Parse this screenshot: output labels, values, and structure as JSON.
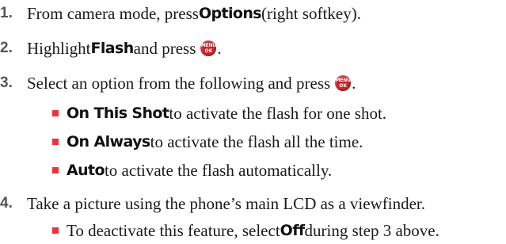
{
  "colors": {
    "bullet": "#e8353a",
    "step_number": "#555555",
    "menu_button": "#c8262b"
  },
  "menu_icon": {
    "icon": "menu-ok-button-icon",
    "top_text": "MENU",
    "bottom_text": "OK"
  },
  "steps": [
    {
      "number": "1.",
      "text_before": "From camera mode, press ",
      "key": "Options",
      "text_after": " (right softkey)."
    },
    {
      "number": "2.",
      "text_before": "Highlight ",
      "key": "Flash",
      "text_after": " and press ",
      "end": "."
    },
    {
      "number": "3.",
      "text_before": "Select an option from the following and press ",
      "end": ".",
      "options": [
        {
          "key": "On This Shot",
          "text": " to activate the flash for one shot."
        },
        {
          "key": "On Always",
          "text": " to activate the flash all the time."
        },
        {
          "key": "Auto",
          "text": " to activate the flash automatically."
        }
      ]
    },
    {
      "number": "4.",
      "text_before": "Take a picture using the phone’s main LCD as a viewfinder.",
      "note": {
        "text_before": "To deactivate this feature, select ",
        "key": "Off",
        "text_after": " during step 3 above."
      }
    }
  ]
}
